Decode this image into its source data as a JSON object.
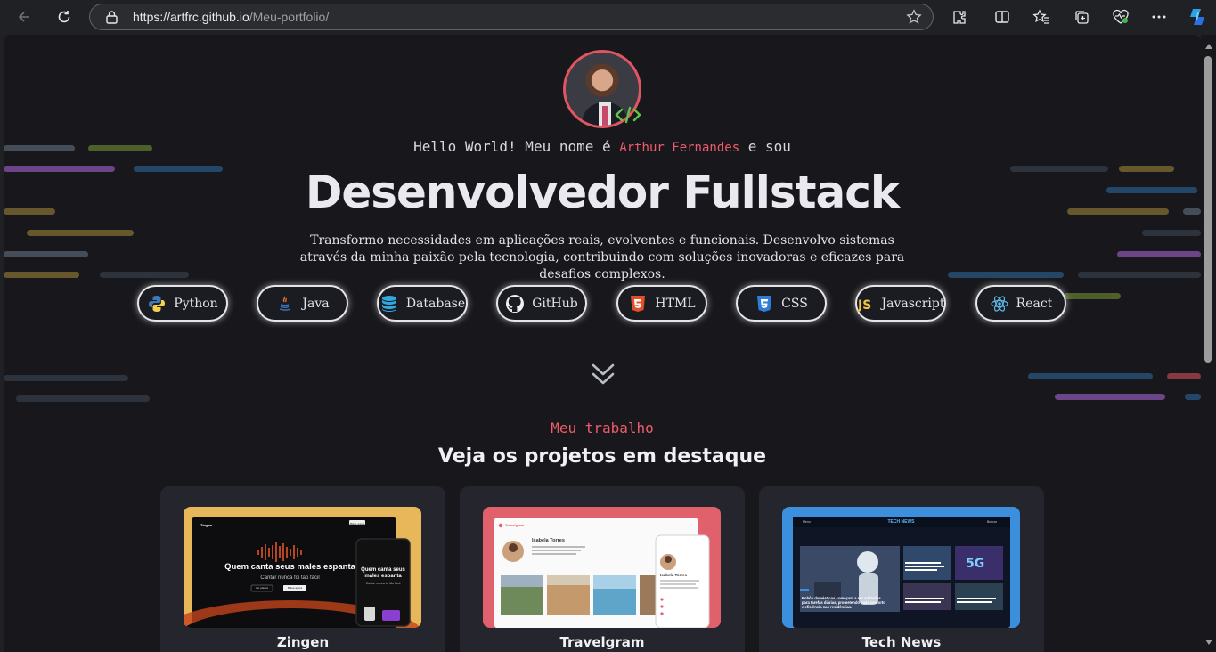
{
  "browser": {
    "url_host": "https://artfrc.github.io",
    "url_path": "/Meu-portfolio/",
    "icons": [
      "back-arrow-icon",
      "reload-icon",
      "lock-icon",
      "favorite-star-icon",
      "extensions-icon",
      "split-screen-icon",
      "favorites-icon",
      "collections-icon",
      "performance-icon",
      "more-icon",
      "copilot-icon"
    ]
  },
  "hero": {
    "greeting_before": "Hello World! Meu nome é ",
    "name": "Arthur Fernandes",
    "greeting_after": " e sou",
    "headline": "Desenvolvedor Fullstack",
    "description": "Transformo necessidades em aplicações reais, evolventes e funcionais. Desenvolvo sistemas através da minha paixão pela tecnologia, contribuindo com soluções inovadoras e eficazes para desafios complexos.",
    "skills": [
      {
        "label": "Python",
        "icon": "python-icon"
      },
      {
        "label": "Java",
        "icon": "java-icon"
      },
      {
        "label": "Database",
        "icon": "database-icon"
      },
      {
        "label": "GitHub",
        "icon": "github-icon"
      },
      {
        "label": "HTML",
        "icon": "html5-icon"
      },
      {
        "label": "CSS",
        "icon": "css3-icon"
      },
      {
        "label": "Javascript",
        "icon": "javascript-icon"
      },
      {
        "label": "React",
        "icon": "react-icon"
      }
    ]
  },
  "work": {
    "kicker": "Meu trabalho",
    "title": "Veja os projetos em destaque",
    "projects": [
      {
        "title": "Zingen",
        "thumb_bg": "#e8b75a",
        "nav_logo": "Zingen",
        "nav_btn": "Baixe agora",
        "heading": "Quem canta seus males espanta",
        "sub": "Cantar nunca foi tão fácil",
        "btn1": "Ver planos",
        "btn2": "Baixe agora",
        "phone_heading": "Quem canta seus males espanta",
        "phone_sub": "Cantar nunca foi tão fácil"
      },
      {
        "title": "Travelgram",
        "thumb_bg": "#e0616c",
        "logo": "Travelgram",
        "profile_name": "Isabela Torres",
        "phone_profile_name": "Isabela Torres"
      },
      {
        "title": "Tech News",
        "thumb_bg": "#3b8fdc",
        "logo": "TECH NEWS",
        "menu_label": "Menu",
        "search_label": "Buscar",
        "headline": "Robôs domésticos começam a ser adotados para tarefas diárias, prometendo mais conforto e eficiência nas residências."
      }
    ]
  },
  "colors": {
    "accent": "#ef5b6b",
    "page_bg": "#18181c",
    "card_bg": "#25262d"
  }
}
